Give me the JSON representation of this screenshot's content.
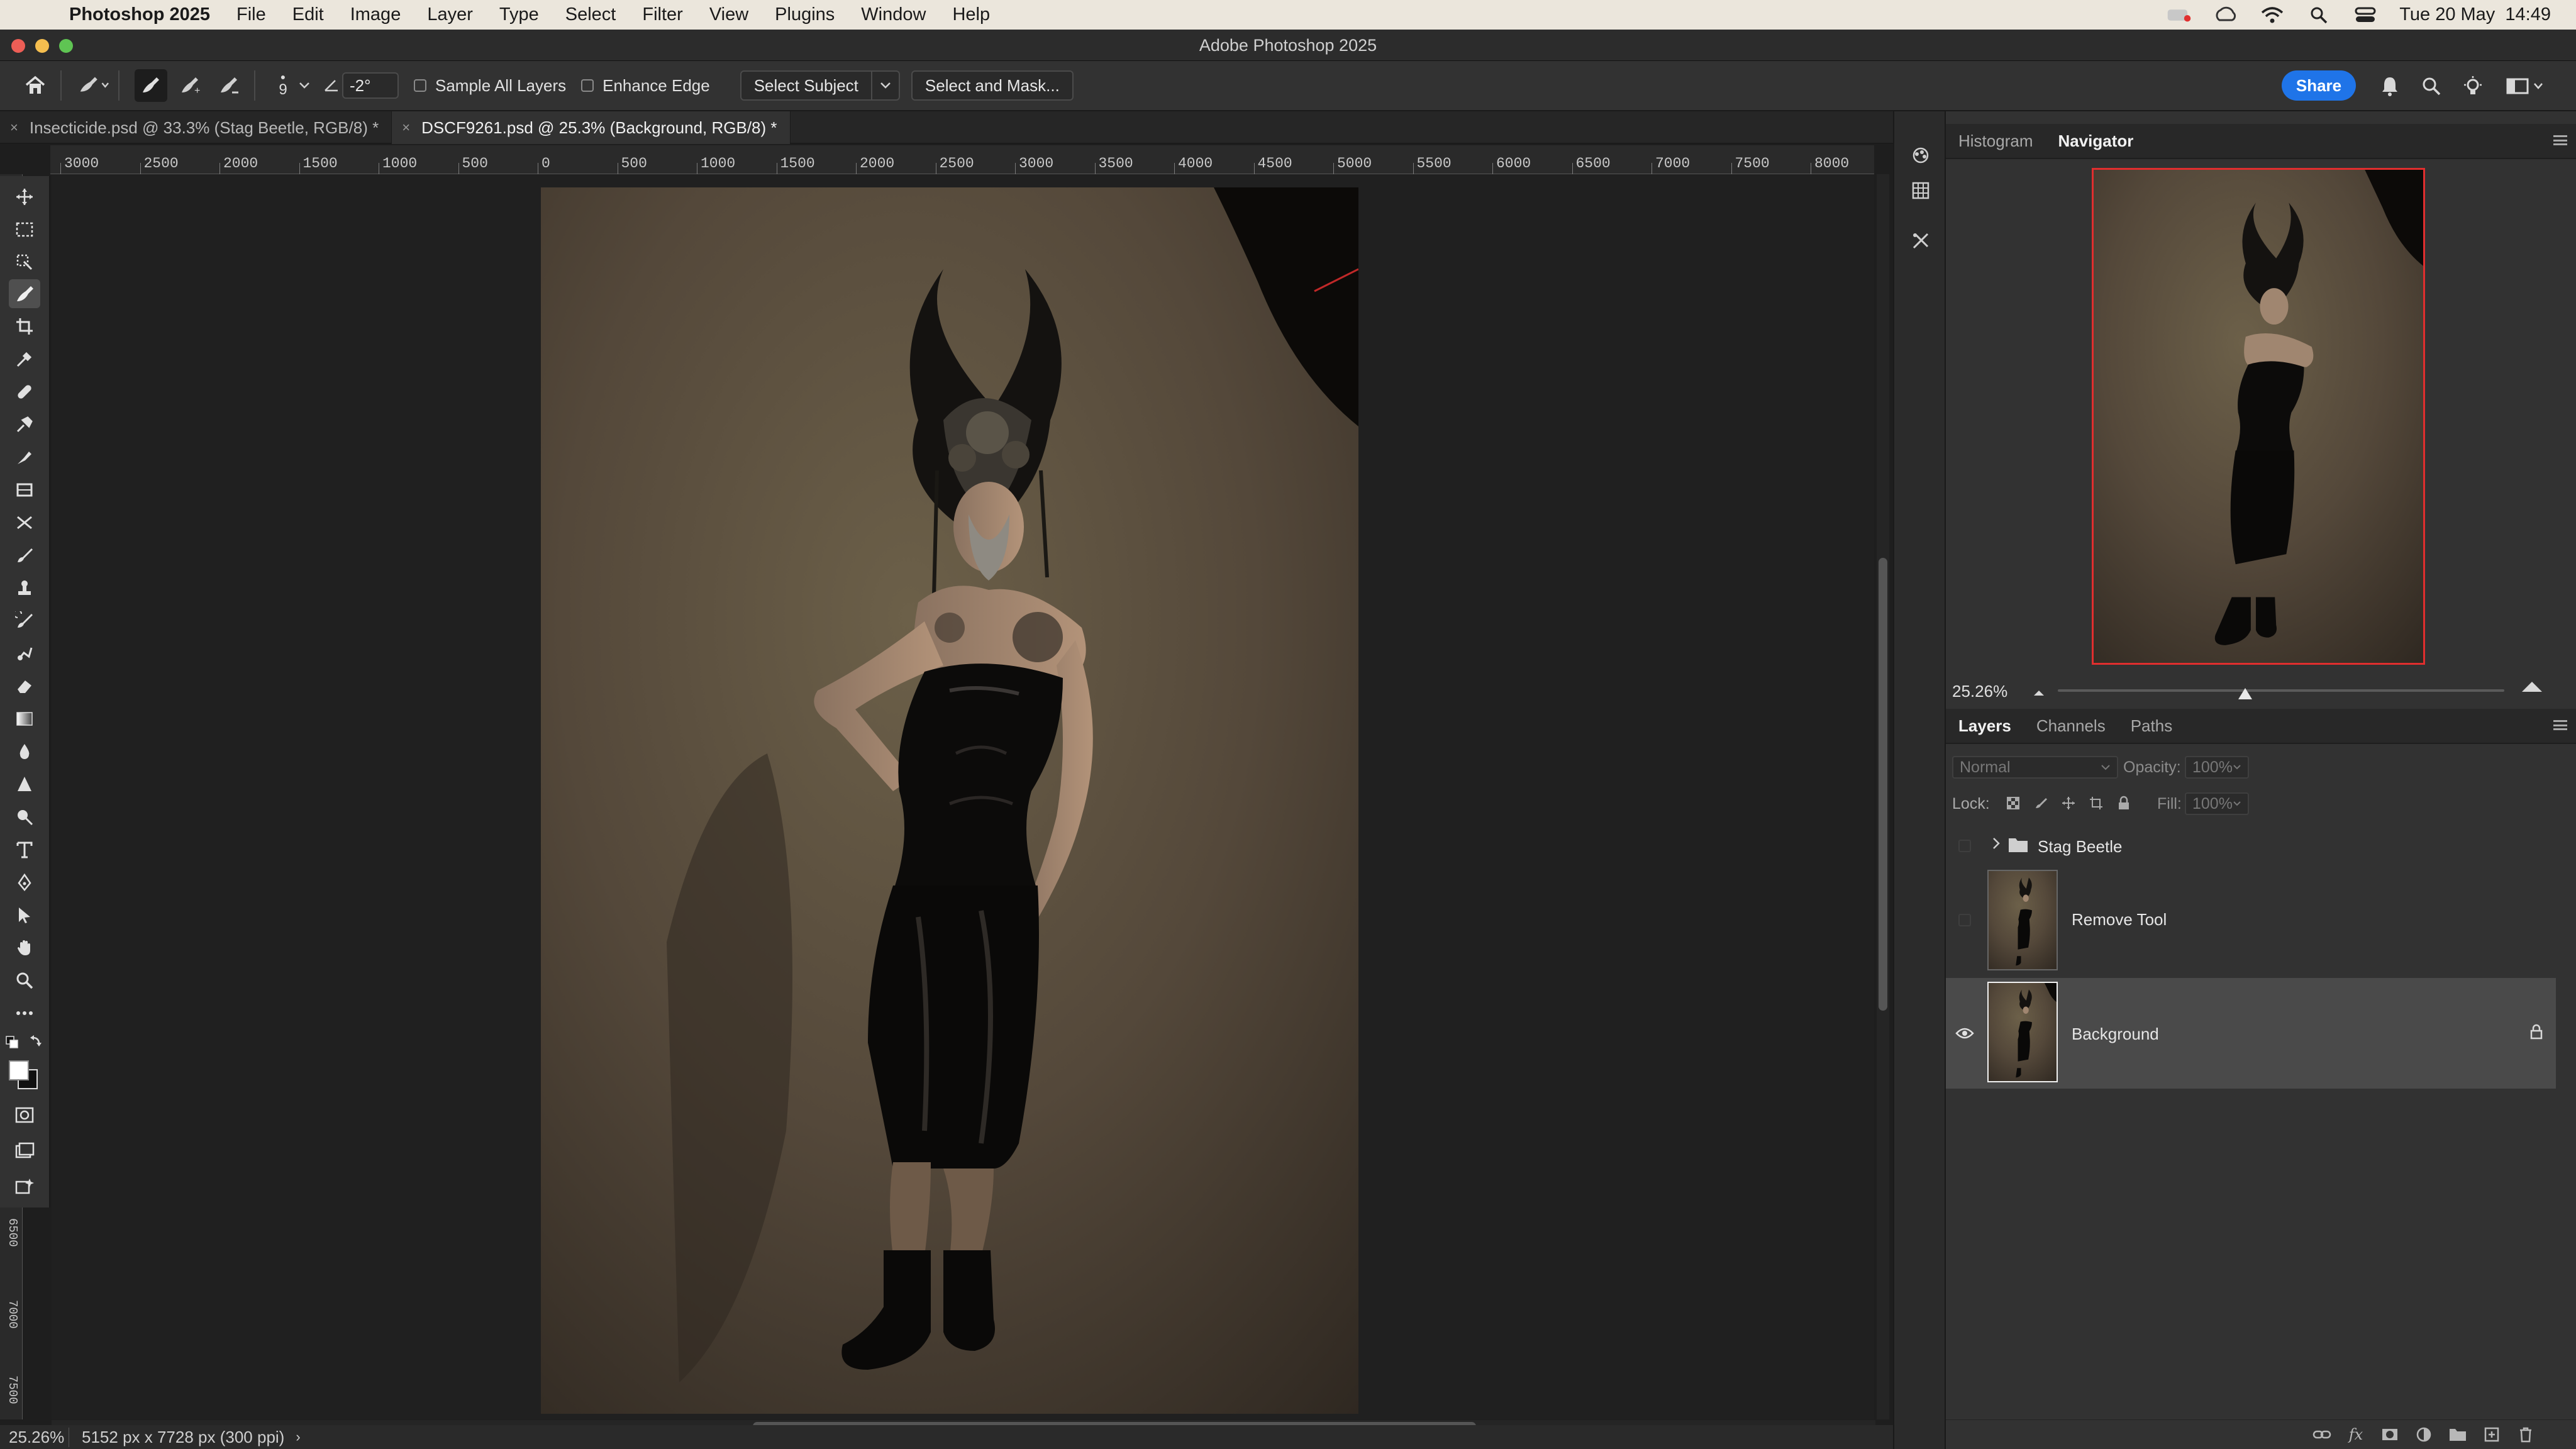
{
  "menubar": {
    "app_name": "Photoshop 2025",
    "items": [
      "File",
      "Edit",
      "Image",
      "Layer",
      "Type",
      "Select",
      "Filter",
      "View",
      "Plugins",
      "Window",
      "Help"
    ],
    "clock": "Tue 20 May  14:49"
  },
  "window": {
    "title": "Adobe Photoshop 2025"
  },
  "options": {
    "brush_size": "9",
    "angle_value": "-2°",
    "sample_all_layers": "Sample All Layers",
    "enhance_edge": "Enhance Edge",
    "select_subject": "Select Subject",
    "select_and_mask": "Select and Mask...",
    "share": "Share"
  },
  "doc_tabs": [
    {
      "label": "Insecticide.psd @ 33.3% (Stag Beetle, RGB/8) *",
      "active": false
    },
    {
      "label": "DSCF9261.psd @ 25.3% (Background, RGB/8) *",
      "active": true
    }
  ],
  "ruler_top": [
    "3000",
    "2500",
    "2000",
    "1500",
    "1000",
    "500",
    "0",
    "500",
    "1000",
    "1500",
    "2000",
    "2500",
    "3000",
    "3500",
    "4000",
    "4500",
    "5000",
    "5500",
    "6000",
    "6500",
    "7000",
    "7500",
    "8000"
  ],
  "ruler_left": [
    "6500",
    "7000",
    "7500"
  ],
  "status": {
    "zoom": "25.26%",
    "dimensions": "5152 px x 7728 px (300 ppi)"
  },
  "panels": {
    "top_tabs": [
      "Histogram",
      "Navigator"
    ],
    "active_top_tab": "Navigator",
    "navigator_zoom": "25.26%",
    "navigator_zoom_fraction": 0.42,
    "layer_tabs": [
      "Layers",
      "Channels",
      "Paths"
    ],
    "blend_mode": "Normal",
    "opacity_label": "Opacity:",
    "opacity_value": "100%",
    "lock_label": "Lock:",
    "fill_label": "Fill:",
    "fill_value": "100%"
  },
  "layers": [
    {
      "name": "Stag Beetle",
      "type": "group",
      "visible": false
    },
    {
      "name": "Remove Tool",
      "type": "pixel",
      "visible": false
    },
    {
      "name": "Background",
      "type": "pixel",
      "visible": true,
      "locked": true,
      "selected": true
    }
  ],
  "colors": {
    "accent": "#1f74e8",
    "navigator_frame": "#e02e2e",
    "panel_bg": "#323232",
    "canvas_bg": "#202020"
  }
}
